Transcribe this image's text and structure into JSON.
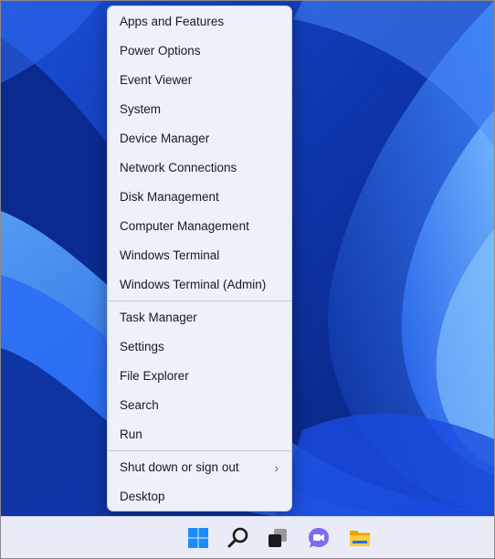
{
  "context_menu": {
    "group1": [
      "Apps and Features",
      "Power Options",
      "Event Viewer",
      "System",
      "Device Manager",
      "Network Connections",
      "Disk Management",
      "Computer Management",
      "Windows Terminal",
      "Windows Terminal (Admin)"
    ],
    "group2": [
      "Task Manager",
      "Settings",
      "File Explorer",
      "Search",
      "Run"
    ],
    "shutdown": "Shut down or sign out",
    "shutdown_chevron": "›",
    "desktop": "Desktop"
  },
  "taskbar": {
    "icons": [
      "windows-start-icon",
      "search-icon",
      "task-view-icon",
      "teams-chat-icon",
      "file-explorer-icon"
    ]
  },
  "colors": {
    "menu_bg": "#eef0fa",
    "taskbar_bg": "#e9ecf6",
    "accent": "#0078d4",
    "wallpaper_dark": "#0a2a86",
    "wallpaper_light": "#4a9bff"
  }
}
